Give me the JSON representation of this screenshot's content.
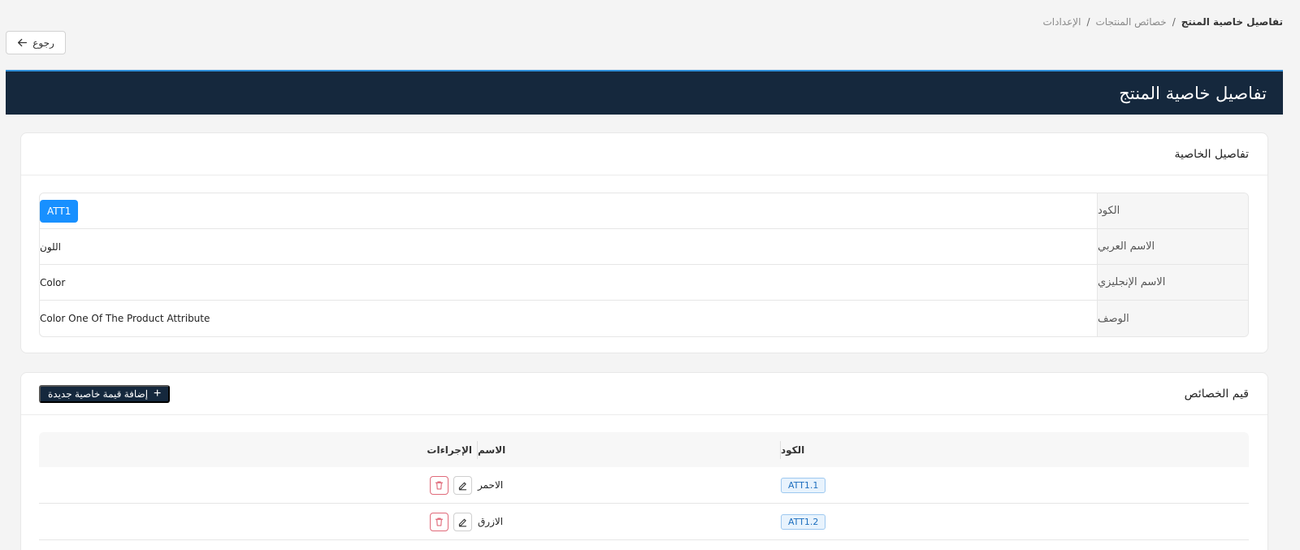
{
  "breadcrumb": {
    "root": "الإعدادات",
    "parent": "خصائص المنتجات",
    "current": "تفاصيل خاصية المنتج",
    "separator": "/"
  },
  "back_button": {
    "label": "رجوع",
    "icon": "arrow-left-icon"
  },
  "header": {
    "title": "تفاصيل خاصية المنتج"
  },
  "details_card": {
    "title": "تفاصيل الخاصية",
    "rows": [
      {
        "key": "الكود",
        "value": "ATT1"
      },
      {
        "key": "الاسم العربي",
        "value": "اللون"
      },
      {
        "key": "الاسم الإنجليزي",
        "value": "Color"
      },
      {
        "key": "الوصف",
        "value": "Color One Of The Product Attribute"
      }
    ]
  },
  "values_card": {
    "title": "قيم الخصائص",
    "add_button": "إضافة قيمة خاصية جديدة",
    "columns": {
      "code": "الكود",
      "name": "الاسم",
      "actions": "الإجراءات"
    },
    "rows": [
      {
        "code": "ATT1.1",
        "name": "الاحمر"
      },
      {
        "code": "ATT1.2",
        "name": "الازرق"
      }
    ]
  },
  "colors": {
    "header_bg": "#15283d",
    "accent": "#1890ff",
    "delete": "#e06a7a"
  }
}
